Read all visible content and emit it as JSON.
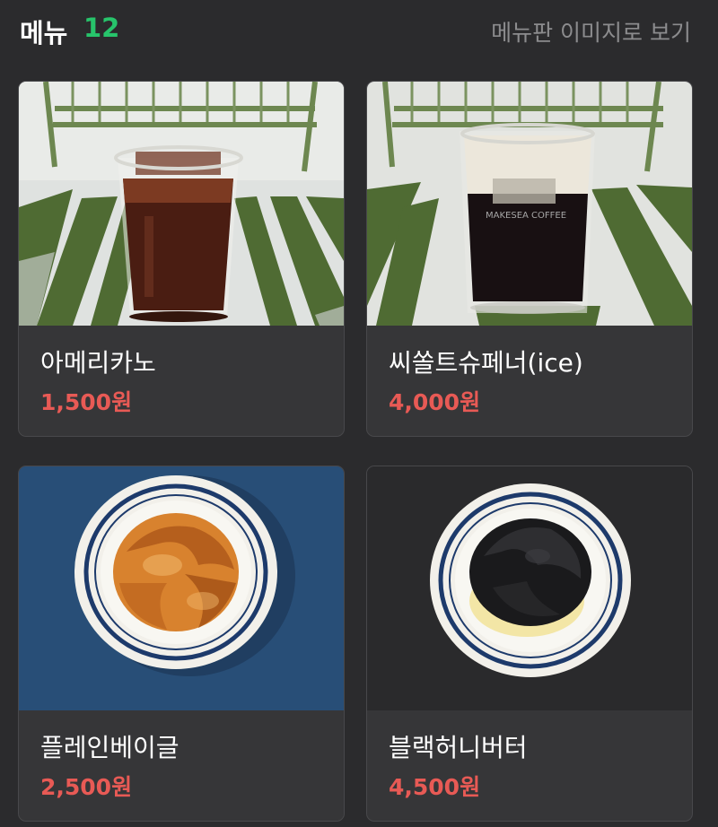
{
  "header": {
    "title": "메뉴",
    "count": "12",
    "view_link": "메뉴판 이미지로 보기"
  },
  "menu": [
    {
      "name": "아메리카노",
      "price": "1,500원",
      "image": "iced-americano-photo"
    },
    {
      "name": "씨쏠트슈페너(ice)",
      "price": "4,000원",
      "image": "sea-salt-einspanner-photo",
      "cup_text": "MAKESEA COFFEE"
    },
    {
      "name": "플레인베이글",
      "price": "2,500원",
      "image": "plain-bagel-photo"
    },
    {
      "name": "블랙허니버터",
      "price": "4,500원",
      "image": "black-honey-butter-bagel-photo"
    }
  ]
}
